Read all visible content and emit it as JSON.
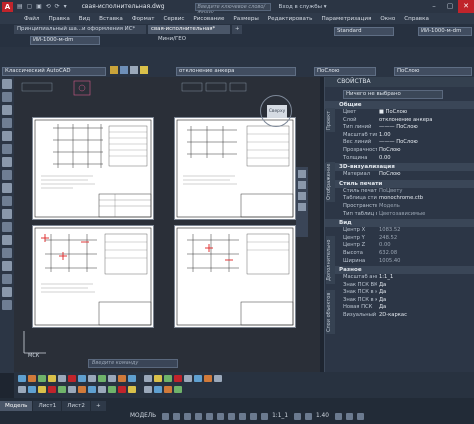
{
  "titlebar": {
    "app_icon": "A",
    "quick_access": "▤ ▢ ▣ ⟲ ⟳ ▾",
    "document_title": "свая-исполнительная.dwg",
    "search_placeholder": "Введите ключевое слово/фразу",
    "login": "Вход в службы ▾",
    "minimize": "–",
    "maximize": "▢",
    "close": "✕"
  },
  "menubar": {
    "items": [
      "Файл",
      "Правка",
      "Вид",
      "Вставка",
      "Формат",
      "Сервис",
      "Рисование",
      "Размеры",
      "Редактировать",
      "Параметризация",
      "Окно",
      "Справка"
    ]
  },
  "tabs": {
    "files": [
      "Принципиальный ша...и оформления ИС*",
      "свая-исполнительная*"
    ],
    "add": "+",
    "left_combo": "ИИ-1000-м-dm",
    "mid_label": "Мини/ГЕО",
    "text_style": "Standard",
    "dim_style": "ИИ-1000-м-dm"
  },
  "layerbar": {
    "workspace": "Классический AutoCAD",
    "layer_current": "отклонение анкера",
    "color": "ПоСлою",
    "linetype": "ПоСлою"
  },
  "canvas": {
    "viewcube_label": "Сверху",
    "wcs_label": "МСК",
    "command_placeholder": "Введите команду"
  },
  "properties": {
    "title": "СВОЙСТВА",
    "selection": "Ничего не выбрано",
    "vertical_tabs": [
      "Проект",
      "Отображение",
      "Дополнительно",
      "Слои объектов"
    ],
    "sections": [
      {
        "name": "Общие",
        "rows": [
          {
            "k": "Цвет",
            "v": "■ ПоСлою"
          },
          {
            "k": "Слой",
            "v": "отклонение анкера"
          },
          {
            "k": "Тип линий",
            "v": "——— ПоСлою"
          },
          {
            "k": "Масштаб тип...",
            "v": "1.00"
          },
          {
            "k": "Вес линий",
            "v": "——— ПоСлою"
          },
          {
            "k": "Прозрачность",
            "v": "ПоСлою"
          },
          {
            "k": "Толщина",
            "v": "0.00"
          }
        ]
      },
      {
        "name": "3D-визуализация",
        "rows": [
          {
            "k": "Материал",
            "v": "ПоСлою"
          }
        ]
      },
      {
        "name": "Стиль печати",
        "rows": [
          {
            "k": "Стиль печати",
            "v": "ПоЦвету"
          },
          {
            "k": "Таблица стиле...",
            "v": "monochrome.ctb"
          },
          {
            "k": "Пространство...",
            "v": "Модель"
          },
          {
            "k": "Тип таблиц печ...",
            "v": "Цветозависимые"
          }
        ]
      },
      {
        "name": "Вид",
        "rows": [
          {
            "k": "Центр X",
            "v": "1083.52"
          },
          {
            "k": "Центр Y",
            "v": "248.52"
          },
          {
            "k": "Центр Z",
            "v": "0.00"
          },
          {
            "k": "Высота",
            "v": "632.08"
          },
          {
            "k": "Ширина",
            "v": "1005.40"
          }
        ]
      },
      {
        "name": "Разное",
        "rows": [
          {
            "k": "Масштаб анно...",
            "v": "1:1_1"
          },
          {
            "k": "Знак ПСК ВКЛ",
            "v": "Да"
          },
          {
            "k": "Знак ПСК в на...",
            "v": "Да"
          },
          {
            "k": "Знак ПСК в ка...",
            "v": "Да"
          },
          {
            "k": "Новая ПСК",
            "v": "Да"
          },
          {
            "k": "Визуальный ст...",
            "v": "2D-каркас"
          }
        ]
      }
    ]
  },
  "layout_tabs": [
    "Модель",
    "Лист1",
    "Лист2",
    "+"
  ],
  "statusbar": {
    "model": "МОДЕЛЬ",
    "scale": "1:1_1",
    "zoom": "1.40"
  }
}
